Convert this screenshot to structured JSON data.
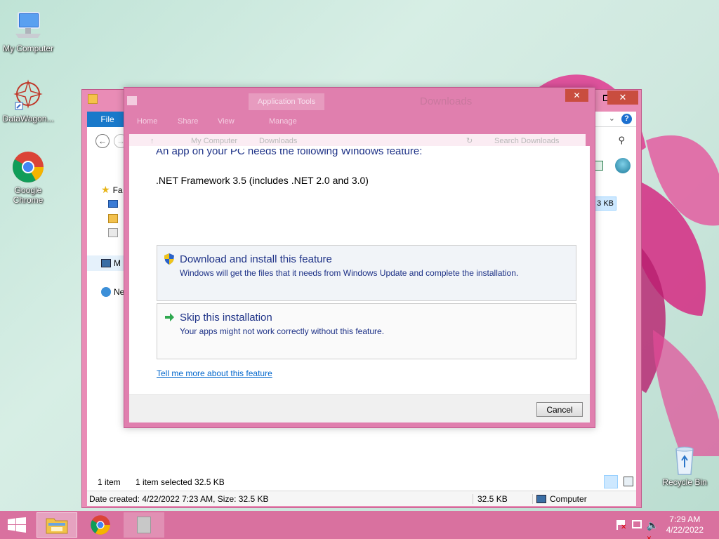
{
  "desktop": {
    "icons": [
      {
        "label": "My Computer",
        "icon": "computer-icon"
      },
      {
        "label": "DataWagon...",
        "icon": "datawagon-icon"
      },
      {
        "label": "Google Chrome",
        "icon": "chrome-icon"
      },
      {
        "label": "Recycle Bin",
        "icon": "recycle-bin-icon"
      }
    ]
  },
  "explorer": {
    "file_tab": "File",
    "nav_items": [
      "Fa",
      "M",
      "Ne"
    ],
    "size_snippet": "3 KB",
    "status_count": "1 item",
    "status_selected": "1 item selected  32.5 KB",
    "details": "Date created: 4/22/2022 7:23 AM, Size: 32.5 KB",
    "details_size": "32.5 KB",
    "details_location": "Computer"
  },
  "ghost": {
    "app_tools": "Application Tools",
    "title": "Downloads",
    "tabs": [
      "Home",
      "Share",
      "View",
      "Manage"
    ],
    "path": [
      "My Computer",
      "Downloads"
    ],
    "search_placeholder": "Search Downloads"
  },
  "dialog": {
    "heading": "An app on your PC needs the following Windows feature:",
    "feature": ".NET Framework 3.5 (includes .NET 2.0 and 3.0)",
    "options": [
      {
        "title": "Download and install this feature",
        "desc": "Windows will get the files that it needs from Windows Update and complete the installation.",
        "icon": "shield-icon"
      },
      {
        "title": "Skip this installation",
        "desc": "Your apps might not work correctly without this feature.",
        "icon": "arrow-right-icon"
      }
    ],
    "more_link": "Tell me more about this feature",
    "cancel": "Cancel"
  },
  "taskbar": {
    "time": "7:29 AM",
    "date": "4/22/2022"
  },
  "colors": {
    "window_frame": "#e98cb6",
    "accent": "#1979ca",
    "link": "#0066cc",
    "heading": "#1e3287"
  }
}
